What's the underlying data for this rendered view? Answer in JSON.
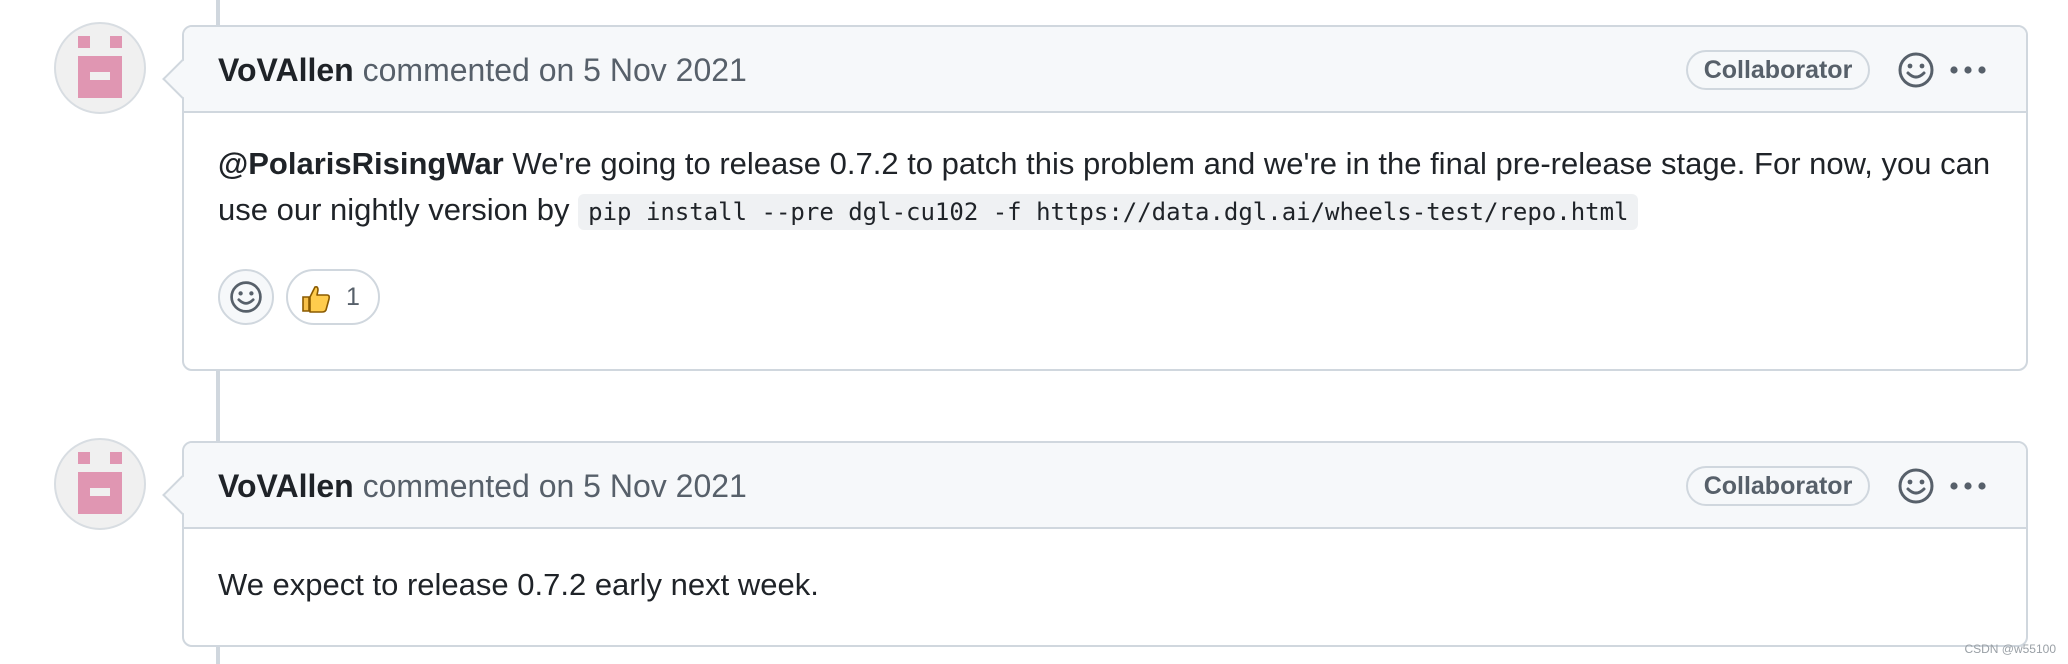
{
  "comments": [
    {
      "author": "VoVAllen",
      "action": "commented on",
      "date": "5 Nov 2021",
      "badge": "Collaborator",
      "mention": "@PolarisRisingWar",
      "text_before_code": " We're going to release 0.7.2 to patch this problem and we're in the final pre-release stage. For now, you can use our nightly version by ",
      "code": "pip install --pre dgl-cu102 -f https://data.dgl.ai/wheels-test/repo.html",
      "reactions": [
        {
          "icon": "thumbs-up-icon",
          "emoji": "👍",
          "count": "1"
        }
      ]
    },
    {
      "author": "VoVAllen",
      "action": "commented on",
      "date": "5 Nov 2021",
      "badge": "Collaborator",
      "body": "We expect to release 0.7.2 early next week."
    }
  ],
  "watermark": "CSDN @w55100",
  "colors": {
    "avatar_pink": "#e096b2",
    "border": "#d0d7de",
    "header_bg": "#f6f8fa"
  }
}
